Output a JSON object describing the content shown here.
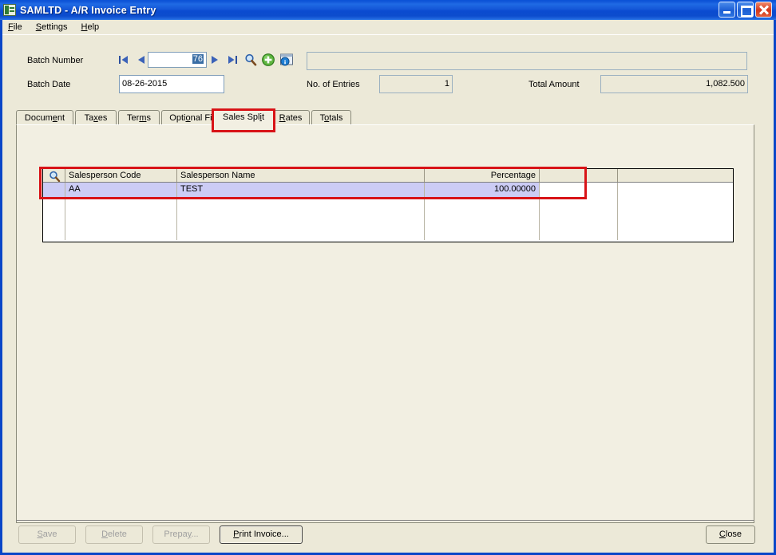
{
  "window": {
    "title": "SAMLTD - A/R Invoice Entry",
    "icon": "application-icon",
    "controls": {
      "minimize": "minimize-button",
      "maximize": "maximize-button",
      "close": "close-button"
    }
  },
  "menu": {
    "items": [
      {
        "label": "File",
        "mnemonic": "F"
      },
      {
        "label": "Settings",
        "mnemonic": "S"
      },
      {
        "label": "Help",
        "mnemonic": "H"
      }
    ]
  },
  "header": {
    "batch_number_label": "Batch Number",
    "batch_number_value": "76",
    "batch_description_value": "",
    "batch_date_label": "Batch Date",
    "batch_date_value": "08-26-2015",
    "entries_label": "No. of Entries",
    "entries_value": "1",
    "total_label": "Total Amount",
    "total_value": "1,082.500",
    "nav": {
      "first": "go-to-first-record",
      "previous": "go-to-previous-record",
      "next": "go-to-next-record",
      "last": "go-to-last-record"
    },
    "tools": {
      "finder": "magnifier-icon",
      "new": "new-record-icon",
      "info": "batch-info-icon"
    }
  },
  "tabs": {
    "active": "Sales Split",
    "items": [
      {
        "label": "Document",
        "mnemonic": "e"
      },
      {
        "label": "Taxes",
        "mnemonic": "x"
      },
      {
        "label": "Terms",
        "mnemonic": "m"
      },
      {
        "label": "Optional Fields",
        "mnemonic": "o"
      },
      {
        "label": "Sales Split",
        "mnemonic": "i"
      },
      {
        "label": "Rates",
        "mnemonic": "R"
      },
      {
        "label": "Totals",
        "mnemonic": "o"
      }
    ]
  },
  "grid": {
    "finder_icon": "magnifier-icon",
    "columns": [
      "",
      "Salesperson Code",
      "Salesperson Name",
      "Percentage",
      "",
      ""
    ],
    "rows": [
      {
        "code": "AA",
        "name": "TEST",
        "percentage": "100.00000",
        "selected": true
      },
      {
        "code": "",
        "name": "",
        "percentage": "",
        "selected": false
      },
      {
        "code": "",
        "name": "",
        "percentage": "",
        "selected": false
      },
      {
        "code": "",
        "name": "",
        "percentage": "",
        "selected": false
      }
    ]
  },
  "footer": {
    "buttons": [
      {
        "label": "Save",
        "mnemonic": "S",
        "enabled": false
      },
      {
        "label": "Delete",
        "mnemonic": "D",
        "enabled": false
      },
      {
        "label": "Prepay...",
        "mnemonic": "y",
        "enabled": false
      },
      {
        "label": "Print Invoice...",
        "mnemonic": "P",
        "enabled": true
      },
      {
        "label": "Close",
        "mnemonic": "C",
        "enabled": true
      }
    ]
  },
  "annotations": {
    "accent_color": "#d81317",
    "highlights": [
      "sales-split-tab",
      "salesperson-grid-row"
    ]
  }
}
